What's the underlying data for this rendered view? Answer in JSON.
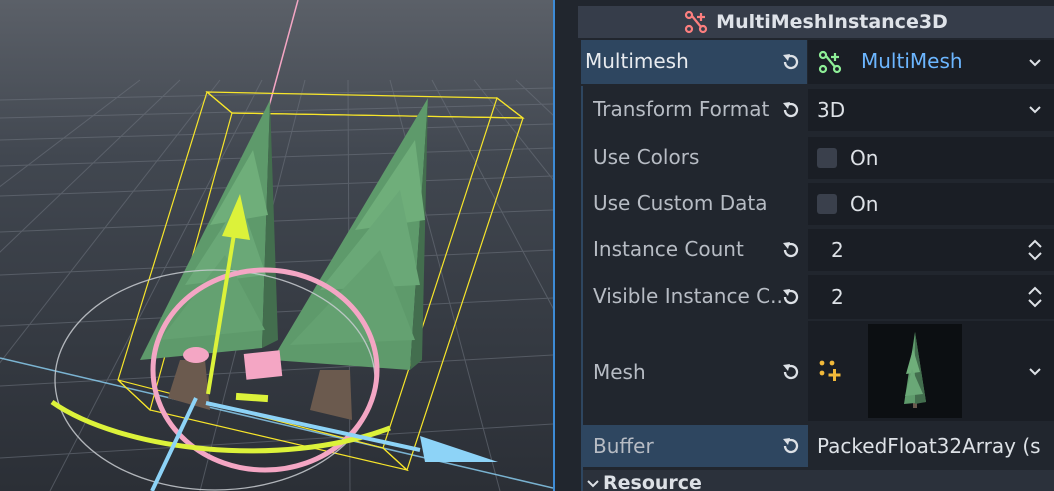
{
  "inspector": {
    "node_type": "MultiMeshInstance3D",
    "multimesh": {
      "label": "Multimesh",
      "value": "MultiMesh"
    },
    "properties": {
      "transform_format": {
        "label": "Transform Format",
        "value": "3D"
      },
      "use_colors": {
        "label": "Use Colors",
        "value": "On",
        "checked": false
      },
      "use_custom_data": {
        "label": "Use Custom Data",
        "value": "On",
        "checked": false
      },
      "instance_count": {
        "label": "Instance Count",
        "value": "2"
      },
      "visible_instance_count": {
        "label": "Visible Instance C...",
        "value": "2"
      },
      "mesh": {
        "label": "Mesh"
      },
      "buffer": {
        "label": "Buffer",
        "value": "PackedFloat32Array (s"
      }
    },
    "resource_section": "Resource"
  },
  "icons": {
    "node": "multimesh-instance-icon",
    "resource": "multimesh-resource-icon",
    "revert": "revert-icon",
    "dropdown": "chevron-down-icon",
    "spinner": "spinner-arrows-icon",
    "mesh_add": "mesh-add-icon",
    "collapse": "chevron-down-icon"
  },
  "colors": {
    "accent": "#3d8bd6",
    "multimesh_row": "#2e4660",
    "resource_link": "#6cb6ff",
    "node_icon": "#fc7f7f",
    "resource_icon": "#8eef97",
    "gizmo_yellow": "#dcf23a",
    "gizmo_pink": "#f4a6c4",
    "gizmo_blue": "#8dd3f7",
    "tree_green": "#5e9a6b",
    "aabb": "#f7e52a"
  }
}
